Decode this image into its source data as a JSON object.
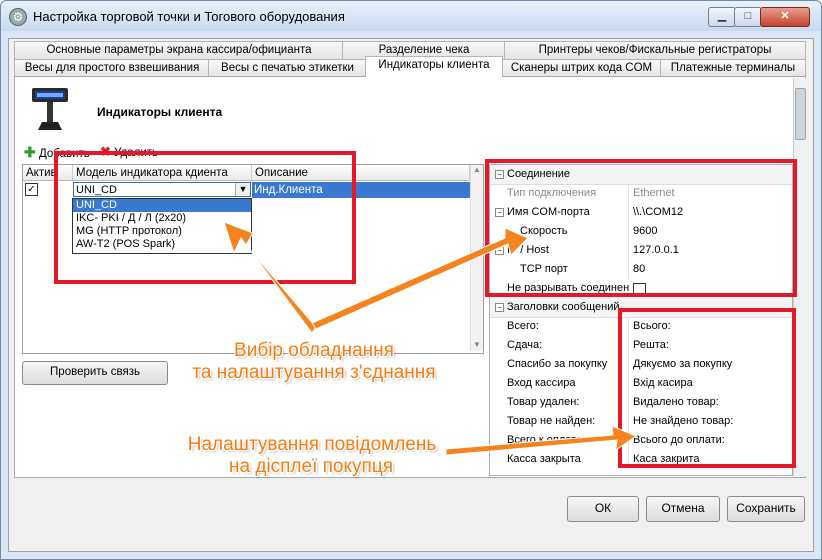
{
  "window": {
    "title": "Настройка торговой точки и Тогового оборудования"
  },
  "tabs": {
    "row1": [
      "Основные параметры экрана кассира/официанта",
      "Разделение чека",
      "Принтеры чеков/Фискальные регистраторы"
    ],
    "row2": [
      "Весы для простого взвешивания",
      "Весы с печатью этикетки",
      "Индикаторы клиента",
      "Сканеры штрих кода COM",
      "Платежные терминалы"
    ],
    "active": "Индикаторы клиента"
  },
  "section": {
    "title": "Индикаторы клиента"
  },
  "toolbar": {
    "add": "Добавить",
    "delete": "Удалить"
  },
  "grid": {
    "columns": [
      "Актив",
      "Модель индикатора кдиента",
      "Описание"
    ],
    "row": {
      "active": true,
      "model": "UNI_CD",
      "description": "Инд.Клиента"
    },
    "dropdown_options": [
      "UNI_CD",
      "IKC- PKI / Д / Л (2x20)",
      "MG (HTTP протокол)",
      "AW-T2 (POS Spark)"
    ],
    "dropdown_selected": "UNI_CD"
  },
  "check_button": "Проверить связь",
  "properties": {
    "connection_category": "Соединение",
    "connection": [
      {
        "name": "Тип подключения",
        "value": "Ethernet",
        "disabled": true
      },
      {
        "name": "Имя COM-порта",
        "value": "\\\\.\\COM12"
      },
      {
        "name": "Скорость",
        "value": "9600"
      },
      {
        "name": "IP / Host",
        "value": "127.0.0.1"
      },
      {
        "name": "TCP порт",
        "value": "80"
      },
      {
        "name": "Не разрывать соединен",
        "value": ""
      }
    ],
    "messages_category": "Заголовки сообщений",
    "messages": [
      {
        "name": "Всего:",
        "value": "Всього:"
      },
      {
        "name": "Сдача:",
        "value": "Решта:"
      },
      {
        "name": "Спасибо за покупку",
        "value": "Дякуємо за покупку"
      },
      {
        "name": "Вход кассира",
        "value": "Вхід касира"
      },
      {
        "name": "Товар удален:",
        "value": "Видалено товар:"
      },
      {
        "name": "Товар не найден:",
        "value": "Не знайдено товар:"
      },
      {
        "name": "Всего к оплате:",
        "value": "Всього до оплати:"
      },
      {
        "name": "Касса закрыта",
        "value": "Каса закрита"
      }
    ]
  },
  "buttons": {
    "ok": "ОК",
    "cancel": "Отмена",
    "save": "Сохранить"
  },
  "annotations": {
    "equipment_line1": "Вибір обладнання",
    "equipment_line2": "та налаштування з'єднання",
    "messages_line1": "Налаштування повідомлень",
    "messages_line2": "на дісплеї покупця"
  },
  "colors": {
    "annotation_red": "#e4182b",
    "annotation_orange": "#f57c10",
    "selection_blue": "#3b78d0"
  },
  "icons": {
    "title": "gear-icon",
    "add": "plus-icon",
    "delete": "red-x-icon",
    "display": "customer-display-icon"
  }
}
